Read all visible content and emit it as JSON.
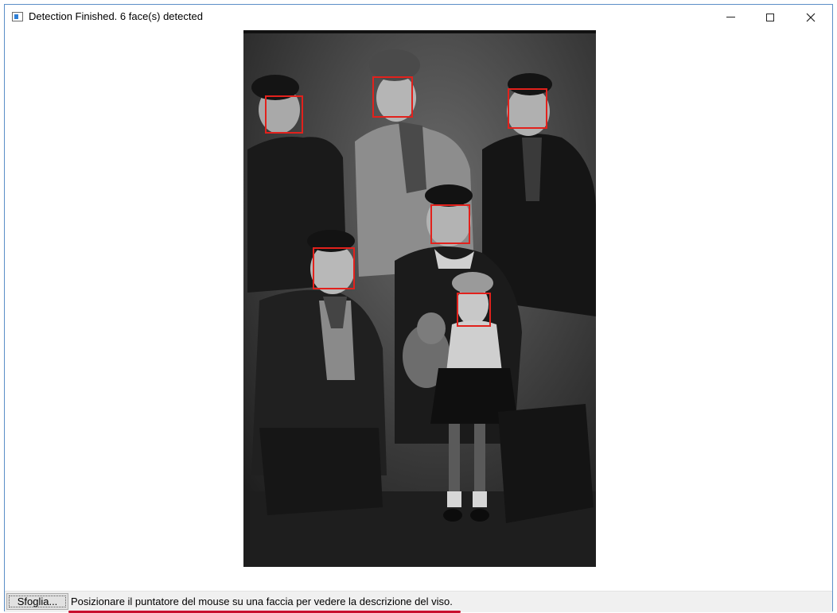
{
  "window": {
    "title": "Detection Finished. 6 face(s) detected"
  },
  "photo": {
    "faces_detected": 6,
    "face_box_color": "#e2211c"
  },
  "bottom_bar": {
    "browse_label": "Sfoglia...",
    "hint_text": "Posizionare il puntatore del mouse su una faccia per vedere la descrizione del viso.",
    "underline_color": "#c8102e"
  },
  "icons": [
    "app-icon",
    "minimize-icon",
    "maximize-icon",
    "close-icon"
  ]
}
